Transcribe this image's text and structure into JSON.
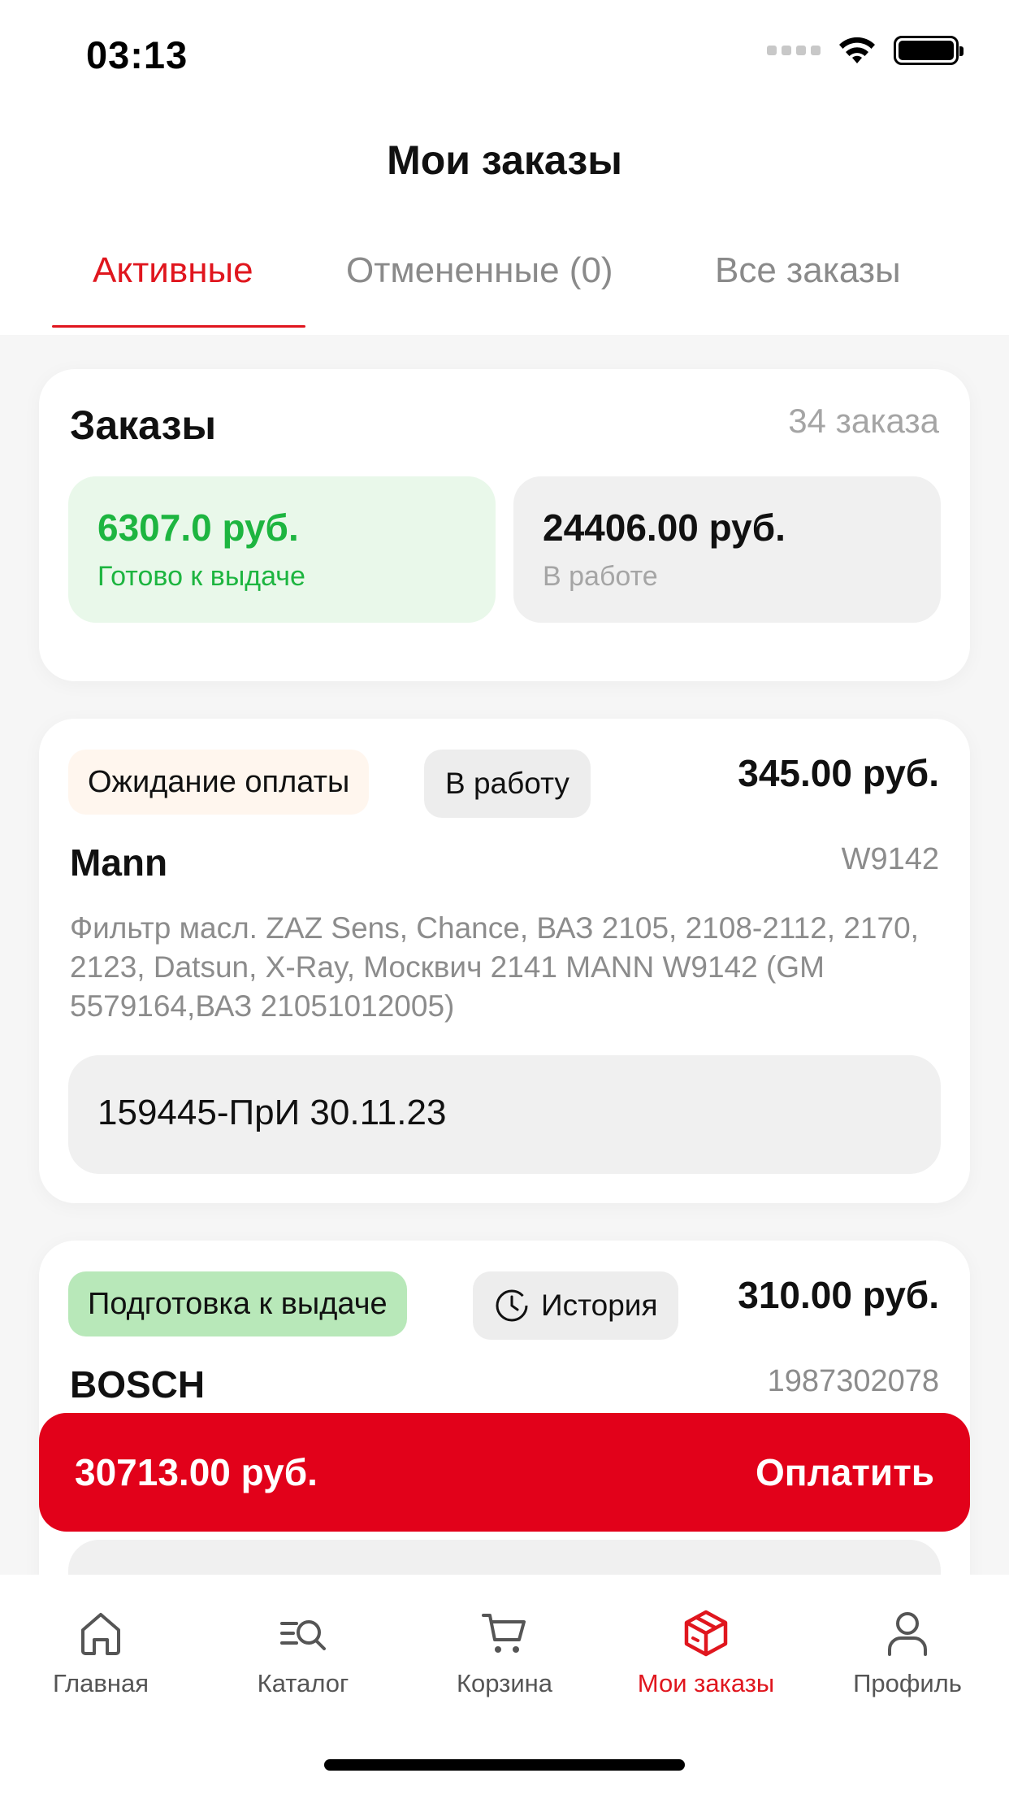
{
  "status_bar": {
    "time": "03:13"
  },
  "header": {
    "title": "Мои заказы"
  },
  "tabs": [
    {
      "label": "Активные",
      "active": true
    },
    {
      "label": "Отмененные (0)",
      "active": false
    },
    {
      "label": "Все заказы",
      "active": false
    }
  ],
  "summary": {
    "title": "Заказы",
    "count": "34 заказа",
    "ready": {
      "value": "6307.0 руб.",
      "label": "Готово к выдаче"
    },
    "in_work": {
      "value": "24406.00 руб.",
      "label": "В работе"
    }
  },
  "orders": [
    {
      "status": "Ожидание оплаты",
      "action": "В работу",
      "price": "345.00 руб.",
      "brand": "Mann",
      "article": "W9142",
      "description": "Фильтр масл. ZAZ Sens, Chance, ВАЗ 2105, 2108-2112, 2170, 2123, Datsun, X-Ray, Москвич 2141 MANN W9142 (GM 5579164,ВАЗ  21051012005)",
      "reference": "159445-ПрИ 30.11.23"
    },
    {
      "status": "Подготовка к выдаче",
      "action": "История",
      "price": "310.00 руб.",
      "brand": "BOSCH",
      "article": "1987302078"
    }
  ],
  "pay_bar": {
    "total": "30713.00 руб.",
    "button": "Оплатить"
  },
  "bottom_nav": [
    {
      "label": "Главная",
      "icon": "home-icon",
      "active": false
    },
    {
      "label": "Каталог",
      "icon": "catalog-search-icon",
      "active": false
    },
    {
      "label": "Корзина",
      "icon": "cart-icon",
      "active": false
    },
    {
      "label": "Мои заказы",
      "icon": "box-icon",
      "active": true
    },
    {
      "label": "Профиль",
      "icon": "profile-icon",
      "active": false
    }
  ],
  "colors": {
    "accent": "#e0161e",
    "pay_bar": "#e2011a",
    "ready_green": "#1db540",
    "ready_bg": "#e9f8ea",
    "prep_badge_bg": "#b8e8b9",
    "await_badge_bg": "#fff6ee"
  }
}
